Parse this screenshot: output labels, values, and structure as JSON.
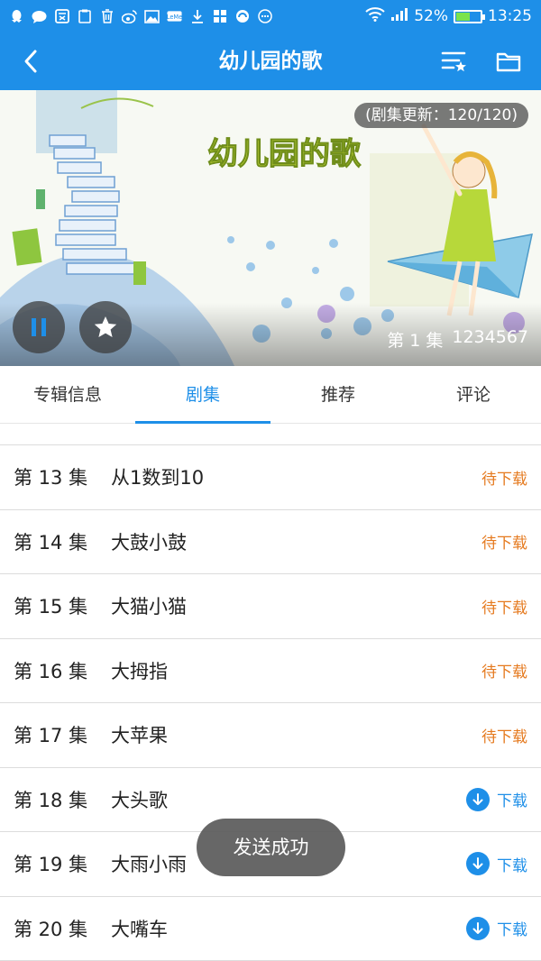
{
  "status_bar": {
    "icons": [
      "qq-icon",
      "chat-icon",
      "friend-icon",
      "clipboard-icon",
      "trash-icon",
      "weibo-icon",
      "image-icon",
      "letv-icon",
      "download-icon",
      "apps-icon",
      "clean-icon",
      "more-icon"
    ],
    "battery": "52%",
    "battery_level": 0.52,
    "time": "13:25"
  },
  "nav": {
    "title": "幼儿园的歌"
  },
  "banner": {
    "art_title": "幼儿园的歌",
    "update_badge": "(剧集更新：120/120)",
    "episode_label": "第 1 集",
    "episode_title": "1234567"
  },
  "tabs": [
    {
      "label": "专辑信息",
      "active": false
    },
    {
      "label": "剧集",
      "active": true
    },
    {
      "label": "推荐",
      "active": false
    },
    {
      "label": "评论",
      "active": false
    }
  ],
  "episodes": [
    {
      "no": "第 13 集",
      "title": "从1数到10",
      "status": "待下载",
      "type": "pending"
    },
    {
      "no": "第 14 集",
      "title": "大鼓小鼓",
      "status": "待下载",
      "type": "pending"
    },
    {
      "no": "第 15 集",
      "title": "大猫小猫",
      "status": "待下载",
      "type": "pending"
    },
    {
      "no": "第 16 集",
      "title": "大拇指",
      "status": "待下载",
      "type": "pending"
    },
    {
      "no": "第 17 集",
      "title": "大苹果",
      "status": "待下载",
      "type": "pending"
    },
    {
      "no": "第 18 集",
      "title": "大头歌",
      "status": "下载",
      "type": "download"
    },
    {
      "no": "第 19 集",
      "title": "大雨小雨",
      "status": "下载",
      "type": "download"
    },
    {
      "no": "第 20 集",
      "title": "大嘴车",
      "status": "下载",
      "type": "download"
    }
  ],
  "toast": "发送成功",
  "colors": {
    "primary": "#1e8fe8",
    "pending": "#e57a1f",
    "text": "#222222"
  }
}
